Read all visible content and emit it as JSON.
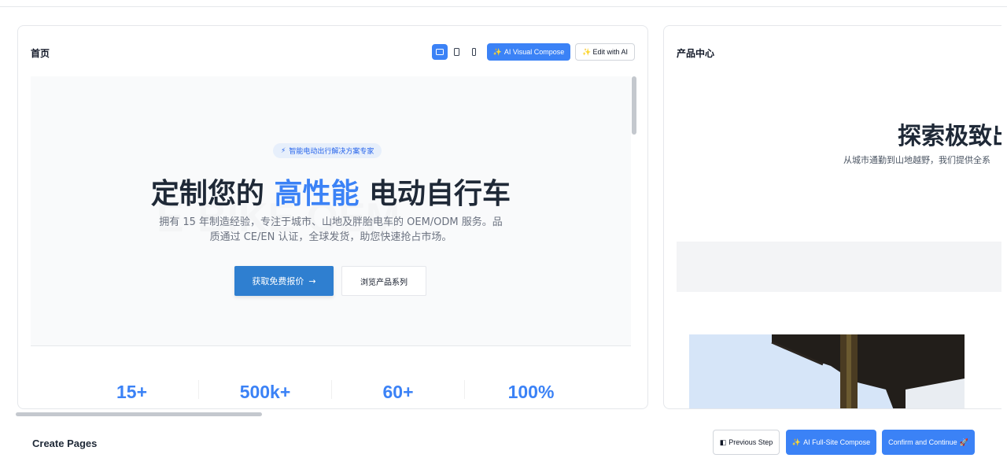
{
  "pages": [
    {
      "title": "首页",
      "toolbar": {
        "devices": [
          "desktop-icon",
          "tablet-icon",
          "mobile-icon"
        ],
        "active_device": "desktop",
        "compose_icon": "✨",
        "compose_label": "AI Visual Compose",
        "edit_icon": "✨",
        "edit_label": "Edit with AI"
      },
      "hero": {
        "badge_icon": "⚡",
        "badge": "智能电动出行解决方案专家",
        "headline_before": "定制您的",
        "headline_highlight": "高性能",
        "headline_after": "电动自行车",
        "subtitle": "拥有 15 年制造经验，专注于城市、山地及胖胎电车的 OEM/ODM 服务。品质通过 CE/EN 认证，全球发货，助您快速抢占市场。",
        "primary_button": "获取免费报价",
        "primary_arrow": "→",
        "secondary_button": "浏览产品系列"
      },
      "stats": [
        "15+",
        "500k+",
        "60+",
        "100%"
      ]
    },
    {
      "title": "产品中心",
      "heading": "探索极致出",
      "subtitle": "从城市通勤到山地越野，我们提供全系"
    }
  ],
  "footer": {
    "title": "Create Pages",
    "prev_icon": "◧",
    "prev_label": "Previous Step",
    "full_icon": "✨",
    "full_label": "AI Full-Site Compose",
    "confirm_label": "Confirm and Continue",
    "confirm_icon": "🚀"
  },
  "colors": {
    "accent": "#3b82f6",
    "primary_button": "#2f7fd0",
    "hero_bg": "#f9fafb"
  }
}
